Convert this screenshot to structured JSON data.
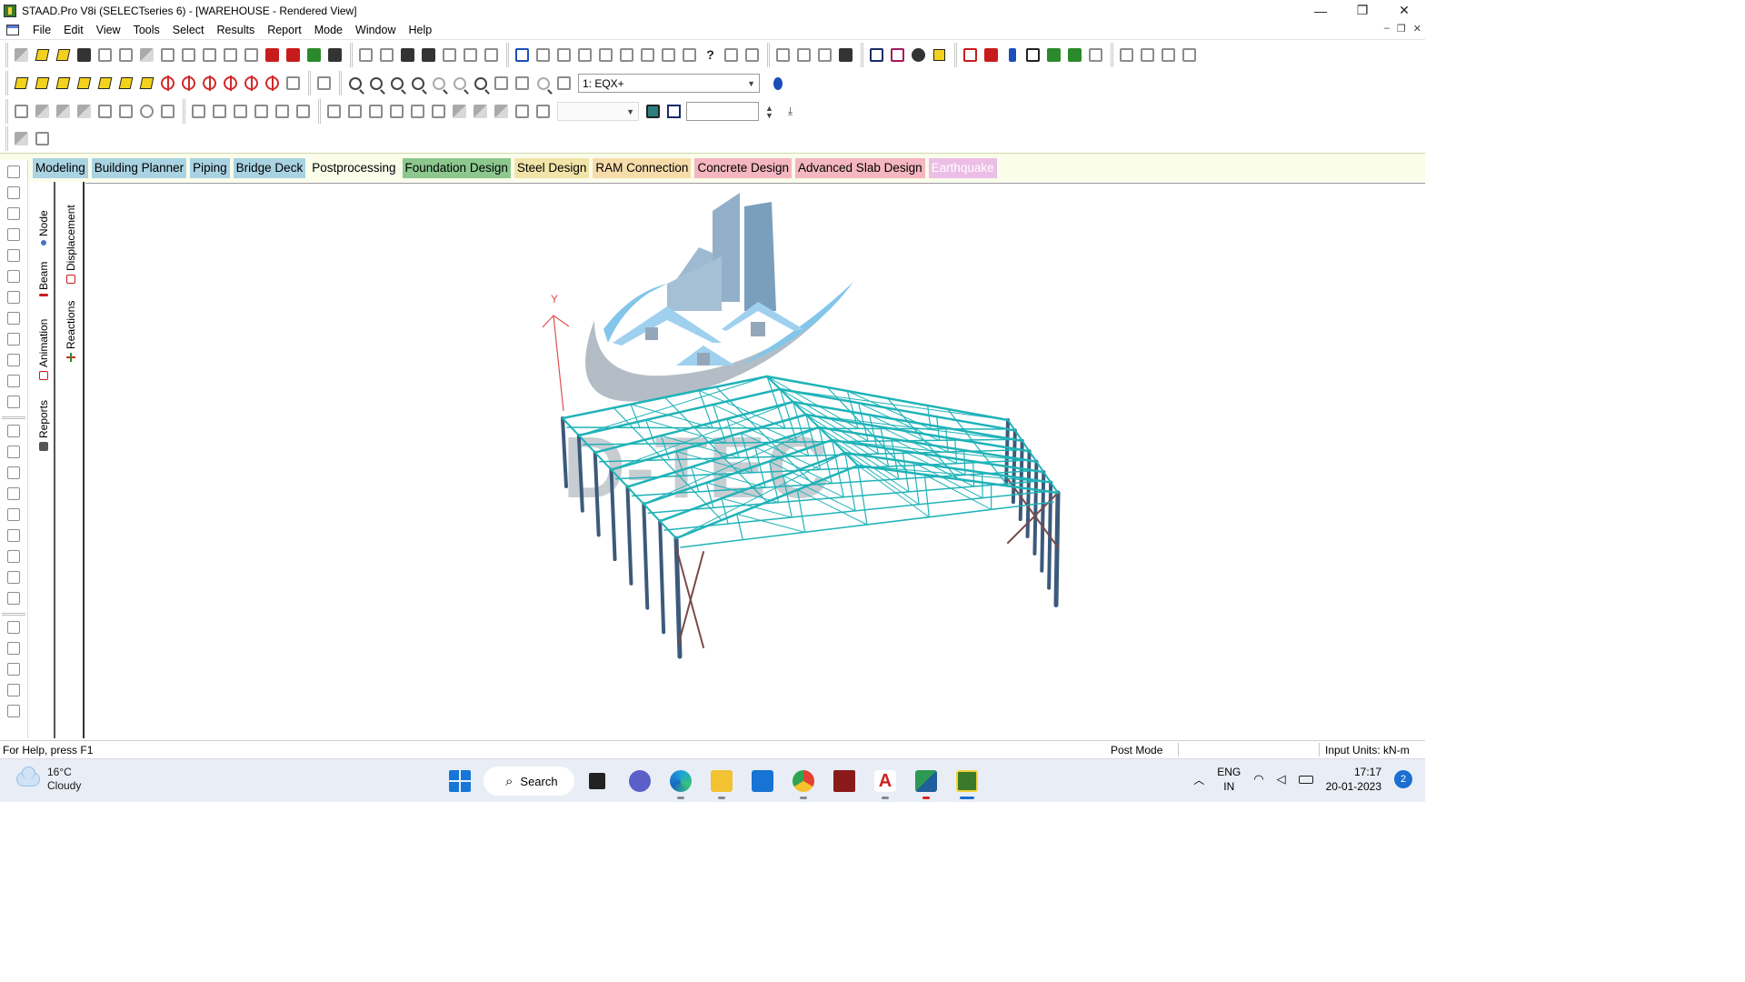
{
  "window": {
    "title": "STAAD.Pro V8i (SELECTseries 6) - [WAREHOUSE - Rendered View]",
    "minimize": "—",
    "maximize": "❐",
    "close": "✕"
  },
  "menu": [
    "File",
    "Edit",
    "View",
    "Tools",
    "Select",
    "Results",
    "Report",
    "Mode",
    "Window",
    "Help"
  ],
  "mdi_controls": [
    "–",
    "❐",
    "✕"
  ],
  "toolbar": {
    "load_case_combo": "1: EQX+",
    "scale_value": ""
  },
  "mode_tabs": [
    {
      "label": "Modeling",
      "bg": "#a9d3e2"
    },
    {
      "label": "Building Planner",
      "bg": "#a9d3e2"
    },
    {
      "label": "Piping",
      "bg": "#a9d3e2"
    },
    {
      "label": "Bridge Deck",
      "bg": "#a9d3e2"
    },
    {
      "label": "Postprocessing",
      "bg": "#fafde9"
    },
    {
      "label": "Foundation Design",
      "bg": "#8cc88e"
    },
    {
      "label": "Steel Design",
      "bg": "#f1e4a8"
    },
    {
      "label": "RAM Connection",
      "bg": "#f6dcaa"
    },
    {
      "label": "Concrete Design",
      "bg": "#f4b6c0"
    },
    {
      "label": "Advanced Slab Design",
      "bg": "#f4b6c0"
    },
    {
      "label": "Earthquake",
      "bg": "#ecbde6"
    }
  ],
  "side_tabs_left": [
    "Node",
    "Beam",
    "Animation",
    "Reports"
  ],
  "side_tabs_right": [
    "Displacement",
    "Reactions"
  ],
  "viewport": {
    "axis_label": "Y",
    "watermark": "D-TEC"
  },
  "statusbar": {
    "help": "For Help, press F1",
    "mode": "Post Mode",
    "units": "Input Units:   kN-m"
  },
  "taskbar": {
    "weather_temp": "16°C",
    "weather_desc": "Cloudy",
    "search_label": "Search",
    "lang_top": "ENG",
    "lang_bottom": "IN",
    "time": "17:17",
    "date": "20-01-2023",
    "notifications": "2"
  }
}
